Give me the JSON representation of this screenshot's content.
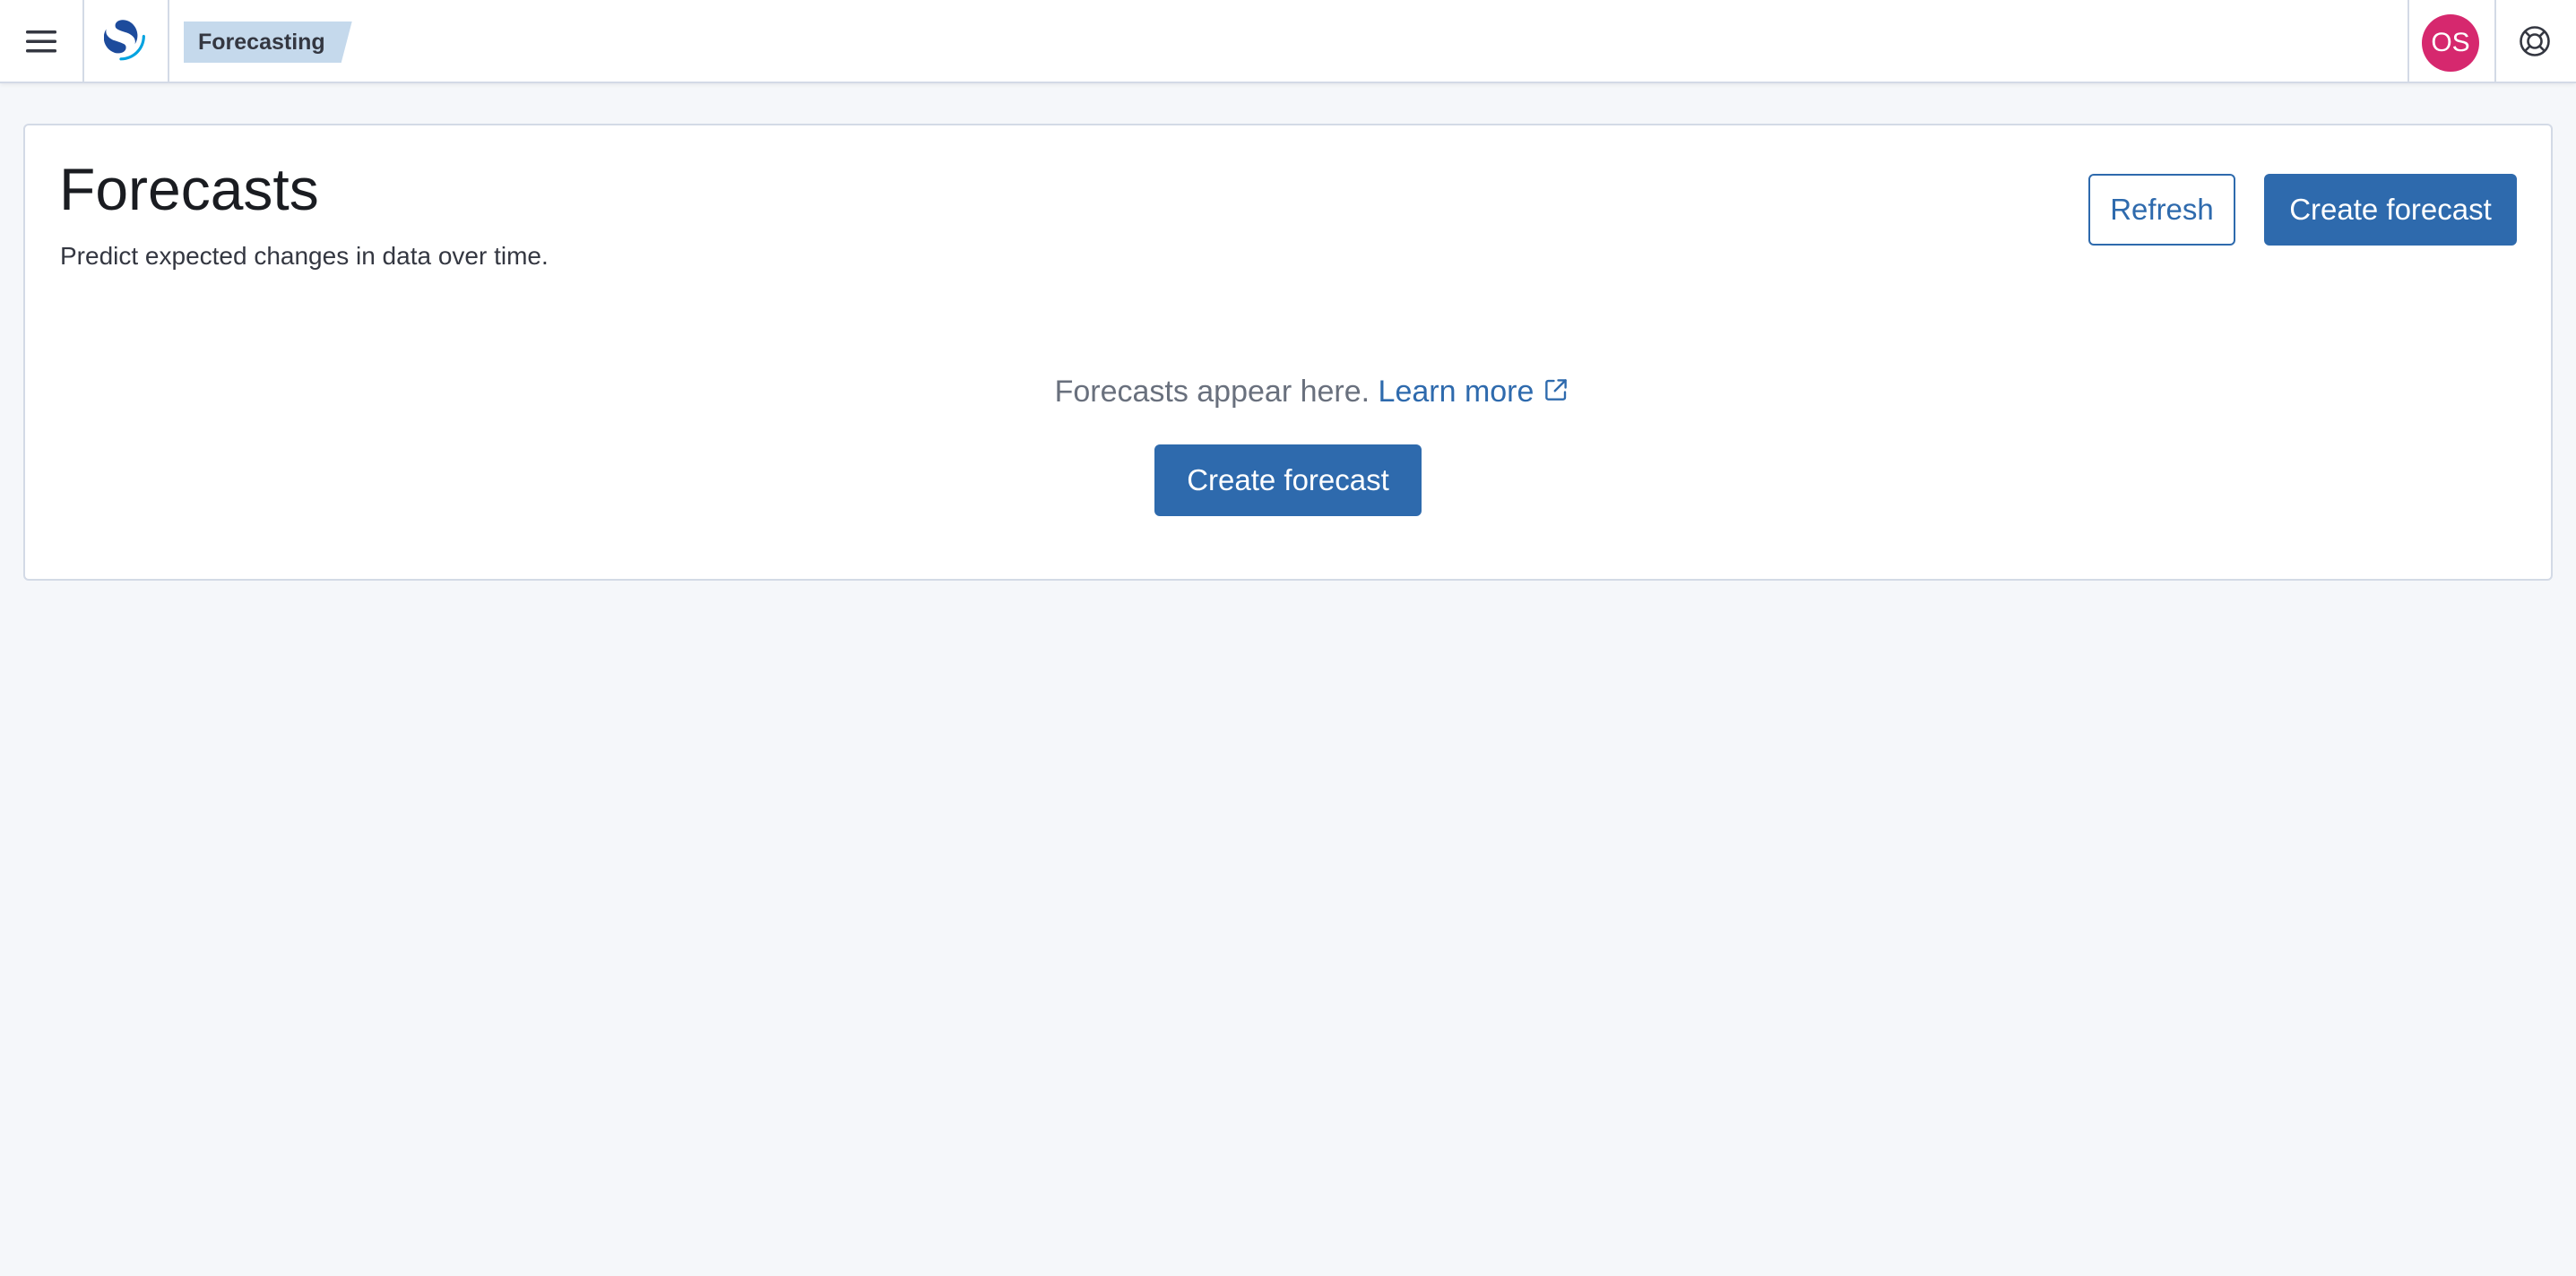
{
  "header": {
    "menu_icon": "hamburger-icon",
    "logo_icon": "opensearch-logo-icon",
    "breadcrumb": "Forecasting",
    "avatar_initials": "OS",
    "avatar_color": "#d6286e",
    "help_icon": "lifebuoy-icon"
  },
  "panel": {
    "title": "Forecasts",
    "subtitle": "Predict expected changes in data over time.",
    "refresh_label": "Refresh",
    "create_label": "Create forecast",
    "empty_state": {
      "text": "Forecasts appear here.",
      "link_label": "Learn more",
      "link_icon": "external-link-icon",
      "create_label": "Create forecast"
    }
  },
  "colors": {
    "primary": "#2e6aad",
    "breadcrumb_bg": "#c5d9ec",
    "page_bg": "#f5f7fa",
    "border": "#d3dae6"
  }
}
